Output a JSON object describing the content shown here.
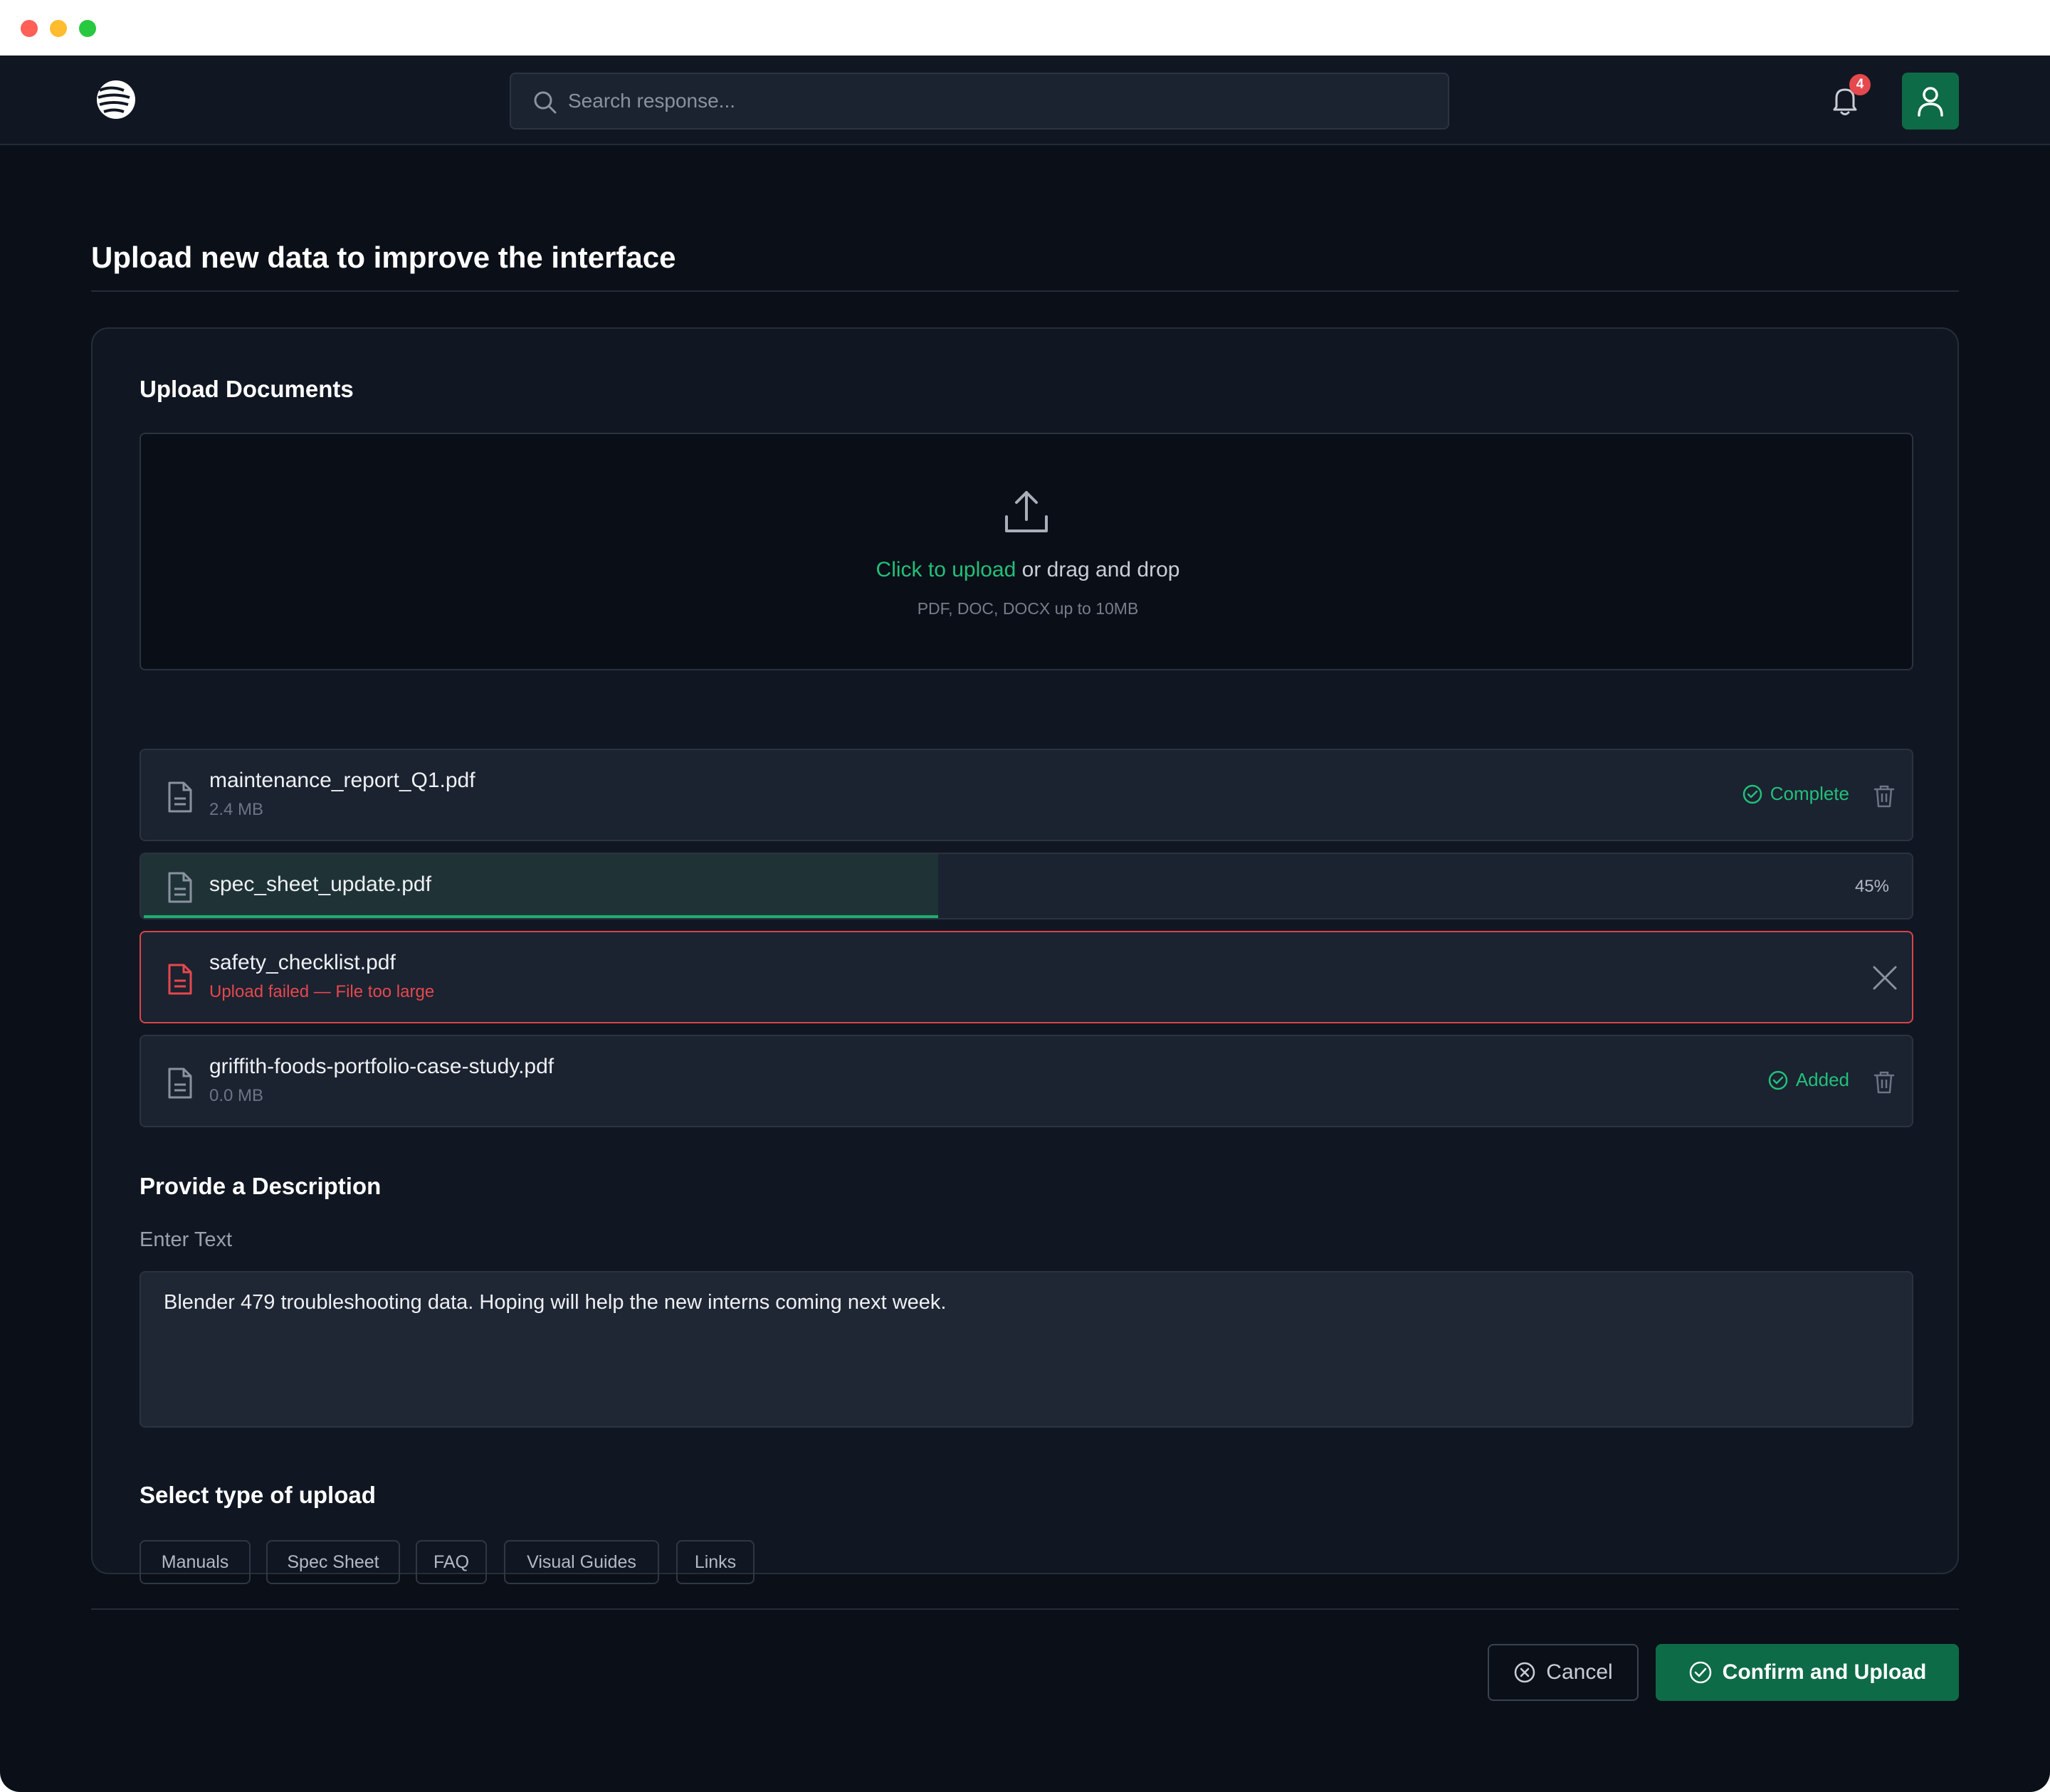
{
  "header": {
    "search_placeholder": "Search response...",
    "notification_count": "4"
  },
  "page": {
    "title": "Upload new data to improve the interface"
  },
  "upload": {
    "section_title": "Upload Documents",
    "dropzone_link": "Click to upload",
    "dropzone_text": " or drag and drop",
    "dropzone_hint": "PDF, DOC, DOCX up to 10MB",
    "files": [
      {
        "name": "maintenance_report_Q1.pdf",
        "size": "2.4 MB",
        "status": "Complete"
      },
      {
        "name": "spec_sheet_update.pdf",
        "progress_percent": 45,
        "progress_label": "45%"
      },
      {
        "name": "safety_checklist.pdf",
        "error": "Upload failed — File too large"
      },
      {
        "name": "griffith-foods-portfolio-case-study.pdf",
        "size": "0.0 MB",
        "status": "Added"
      }
    ]
  },
  "description": {
    "section_title": "Provide a Description",
    "field_label": "Enter Text",
    "value": "Blender 479 troubleshooting data. Hoping will help the new interns coming next week."
  },
  "upload_type": {
    "section_title": "Select type of upload",
    "options": [
      "Manuals",
      "Spec Sheet",
      "FAQ",
      "Visual Guides",
      "Links"
    ]
  },
  "actions": {
    "cancel_label": "Cancel",
    "confirm_label": "Confirm and Upload"
  },
  "colors": {
    "accent": "#22c07a",
    "primary_button": "#0e6b47",
    "error": "#e5484d",
    "background": "#0b0f17"
  }
}
